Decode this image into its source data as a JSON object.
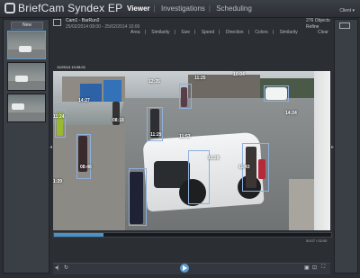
{
  "app": {
    "name": "BriefCam Syndex EP",
    "user_link": "Client ▾"
  },
  "nav": {
    "tabs": [
      "Viewer",
      "Investigations",
      "Scheduling"
    ],
    "active": "Viewer"
  },
  "left_panel": {
    "new_button": "New"
  },
  "case": {
    "name": "Cam1 - BarRun2",
    "date_range": "25/02/2014 08:00 - 25/02/2014 10:00",
    "object_count": "276 Objects",
    "refine": "Refine",
    "filters": [
      "Area",
      "Similarity",
      "Size",
      "Speed",
      "Direction",
      "Colors",
      "Similarity"
    ],
    "clear": "Clear"
  },
  "video": {
    "timestamp": "11/25/14 10:08:01",
    "labels": [
      "12:35",
      "11:25",
      "10:04",
      "14:27",
      "08:18",
      "11:24",
      "11:29",
      "11:53",
      "08:46",
      "11:28",
      "11:43",
      "1:29",
      "14:24"
    ]
  },
  "playback": {
    "timecode": "00:07 / 02:00",
    "progress": 0.18
  },
  "icons": {
    "logo": "briefcam-logo-icon",
    "play": "play-icon"
  },
  "colors": {
    "accent": "#4a93c9",
    "background": "#2b2e33"
  }
}
